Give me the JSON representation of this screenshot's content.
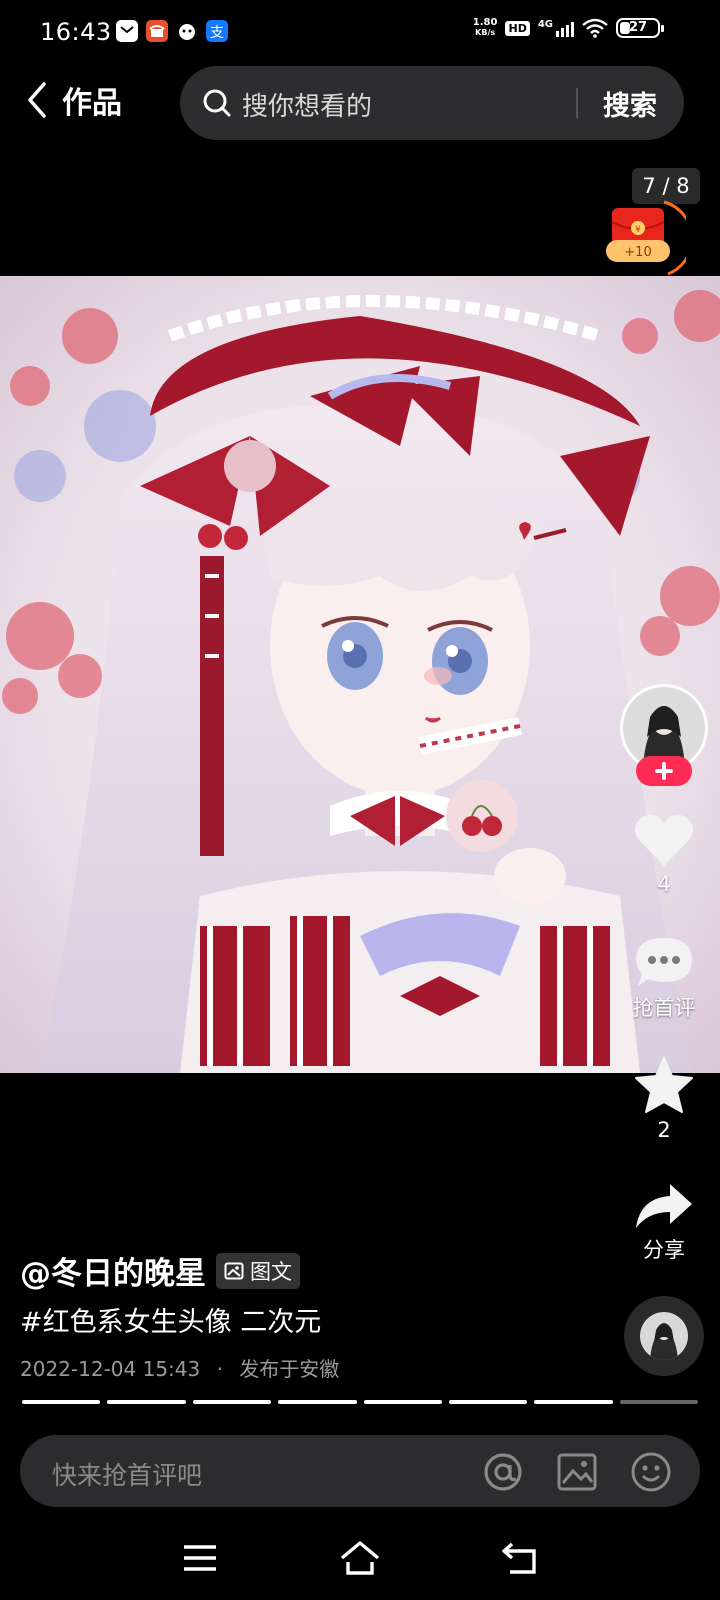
{
  "status_bar": {
    "time": "16:43",
    "net_speed_value": "1.80",
    "net_speed_unit": "KB/s",
    "hd": "HD",
    "signal_label": "4G",
    "battery": "27",
    "battery_level_percent": 27,
    "notification_icons": [
      "mail-icon",
      "shop-icon",
      "pet-icon",
      "alipay-icon"
    ]
  },
  "header": {
    "title": "作品",
    "search_placeholder": "搜你想看的",
    "search_button": "搜索"
  },
  "page_indicator": "7 / 8",
  "red_packet": {
    "bonus": "+10",
    "coin": "¥"
  },
  "image": {
    "subject": "anime-girl-illustration"
  },
  "actions": {
    "follow": "+",
    "like_count": "4",
    "comment_label": "抢首评",
    "favorite_count": "2",
    "share_label": "分享"
  },
  "post": {
    "author": "@冬日的晚星",
    "type_badge": "图文",
    "caption": "#红色系女生头像 二次元",
    "date": "2022-12-04 15:43",
    "separator": "·",
    "location": "发布于安徽"
  },
  "progress": {
    "total": 8,
    "current": 7
  },
  "comment_bar": {
    "placeholder": "快来抢首评吧"
  },
  "colors": {
    "accent_red": "#fe2c55",
    "background": "#000000"
  }
}
